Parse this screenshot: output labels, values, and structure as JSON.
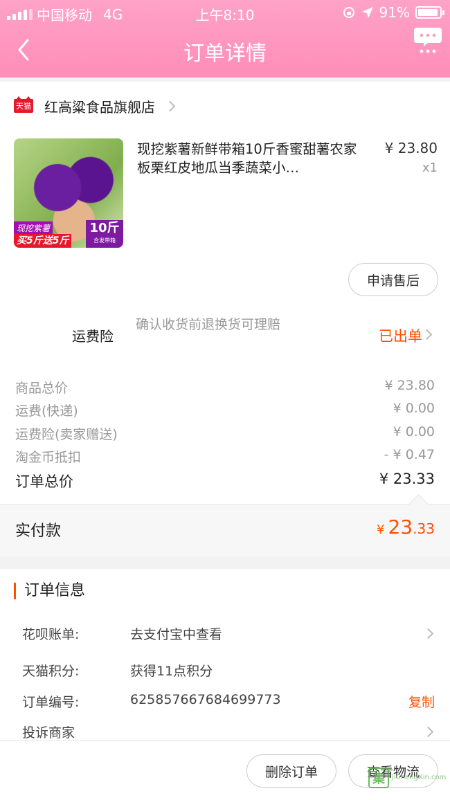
{
  "status_bar": {
    "carrier": "中国移动",
    "network": "4G",
    "time": "上午8:10",
    "battery": "91%"
  },
  "nav": {
    "title": "订单详情"
  },
  "store": {
    "badge": "天猫",
    "name": "红高粱食品旗舰店"
  },
  "product": {
    "title": "现挖紫薯新鲜带箱10斤香蜜甜薯农家板栗红皮地瓜当季蔬菜小…",
    "price": "¥ 23.80",
    "qty": "x1",
    "image_tag1": "现挖紫薯",
    "image_tag2": "买5斤送5斤",
    "image_box_big": "10斤",
    "image_box_small": "合发带箱"
  },
  "after_sale_button": "申请售后",
  "insurance": {
    "label": "运费险",
    "desc": "确认收货前退换货可理赔",
    "status": "已出单"
  },
  "fees": [
    {
      "label": "商品总价",
      "value": "¥ 23.80"
    },
    {
      "label": "运费(快递)",
      "value": "¥ 0.00"
    },
    {
      "label": "运费险(卖家赠送)",
      "value": "¥ 0.00"
    },
    {
      "label": "淘金币抵扣",
      "value": "- ¥ 0.47"
    }
  ],
  "order_total": {
    "label": "订单总价",
    "value": "¥ 23.33"
  },
  "paid": {
    "label": "实付款",
    "currency": "¥",
    "int": "23",
    "dec": ".33"
  },
  "order_info": {
    "title": "订单信息",
    "rows": [
      {
        "key": "花呗账单:",
        "value": "去支付宝中查看"
      },
      {
        "key": "天猫积分:",
        "value": "获得11点积分"
      },
      {
        "key": "订单编号:",
        "value": "625857667684699773",
        "action": "复制"
      },
      {
        "key": "投诉商家",
        "value": ""
      }
    ]
  },
  "bottom": {
    "delete_label": "删除订单",
    "logistics_label": "查看物流"
  },
  "watermark": {
    "logo": "集",
    "text": "JiChengXin.com"
  },
  "colors": {
    "accent": "#ff5000",
    "header": "#ff98bd",
    "tmall_red": "#e7182c"
  }
}
